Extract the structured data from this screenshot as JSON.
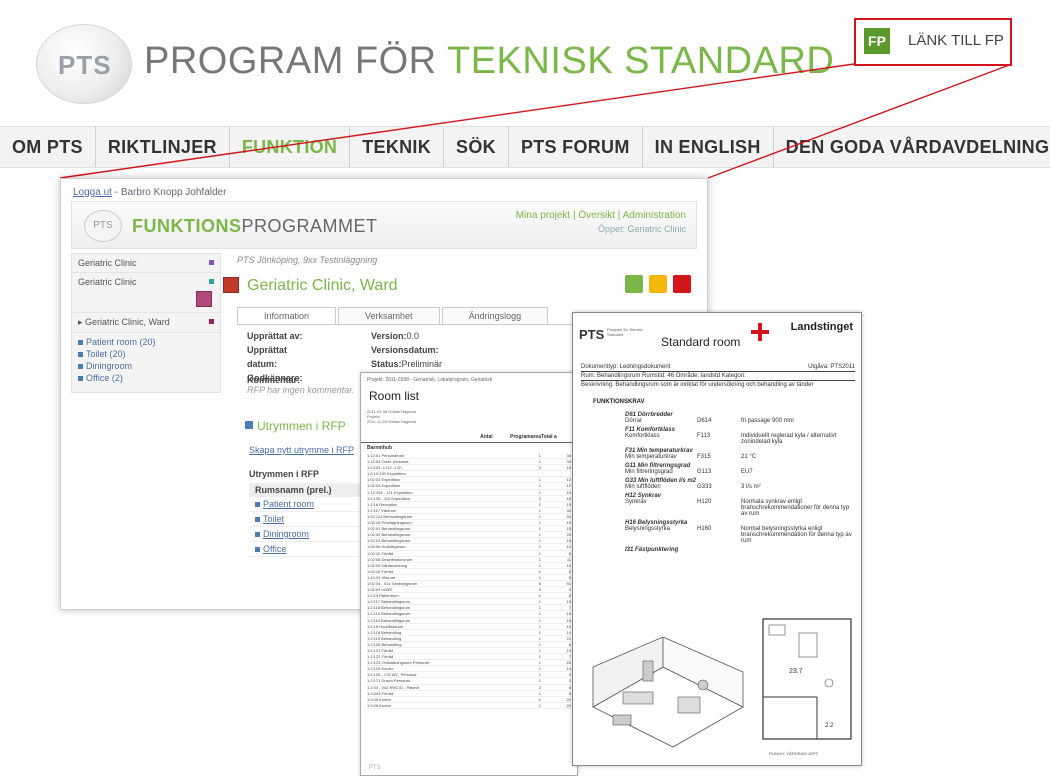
{
  "site": {
    "logo": "PTS",
    "title_part1": "PROGRAM FÖR ",
    "title_part2": "TEKNISK STANDARD",
    "fp_badge": "FP",
    "fp_link": "LÄNK TILL FP"
  },
  "nav": [
    {
      "label": "OM PTS",
      "color": "#333333"
    },
    {
      "label": "RIKTLINJER",
      "color": "#333333"
    },
    {
      "label": "FUNKTION",
      "color": "#7ab648"
    },
    {
      "label": "TEKNIK",
      "color": "#333333"
    },
    {
      "label": "SÖK",
      "color": "#333333"
    },
    {
      "label": "PTS FORUM",
      "color": "#333333"
    },
    {
      "label": "IN ENGLISH",
      "color": "#333333"
    },
    {
      "label": "DEN GODA VÅRDAVDELNINGEN",
      "color": "#333333"
    }
  ],
  "app": {
    "logout_link": "Logga ut",
    "user": " - Barbro Knopp Johfalder",
    "logo": "PTS",
    "title_part1": "FUNKTIONS",
    "title_part2": "PROGRAMMET",
    "links": "Mina projekt | Översikt | Administration",
    "open": "Öppet: Geriatric Clinic",
    "left": {
      "rows": [
        {
          "label": "Geriatric Clinic",
          "dot": "#8a4fc0"
        },
        {
          "label": "Geriatric Clinic",
          "dot": "#2aa3a3"
        }
      ],
      "ward": "▸ Geriatric Clinic, Ward",
      "ward_dot": "#a0245a",
      "items": [
        "Patient room (20)",
        "Toilet (20)",
        "Diningroom",
        "Office (2)"
      ]
    },
    "crumb": "PTS Jönköping, 9xx Testinläggning",
    "room_title": "Geriatric Clinic, Ward",
    "tabs": [
      "Information",
      "Verksamhet",
      "Ändringslogg"
    ],
    "info_left": [
      {
        "k": "Upprättat av:",
        "v": ""
      },
      {
        "k": "Upprättat datum:",
        "v": ""
      },
      {
        "k": "Godkännare:",
        "v": ""
      }
    ],
    "info_right": [
      {
        "k": "Version:",
        "v": "0.0"
      },
      {
        "k": "Versionsdatum:",
        "v": ""
      },
      {
        "k": "Status:",
        "v": "Preliminär"
      }
    ],
    "komm_label": "Kommentar:",
    "komm_text": "RFP har ingen kommentar.",
    "utr_title": "Utrymmen i RFP",
    "utr_new": "Skapa nytt utrymme i RFP",
    "utr_list": "Utrymmen i RFP",
    "utr_th": "Rumsnamn (prel.)",
    "utr_rows": [
      "Patient room",
      "Toilet",
      "Diningroom",
      "Office"
    ]
  },
  "roomlist": {
    "top": "Projekt: 2011-0398 - Geriatrisk, Lokalprogram, Geriatrisk",
    "title": "Room list",
    "meta": [
      "2011-09-08  Gösan Hagtund",
      "Projekt:",
      "2011-11-26  Gösan Hagtund"
    ],
    "cols": [
      "",
      "Antal",
      "Programarea",
      "Total a"
    ],
    "section": "Barnmhub",
    "rows": [
      [
        "1:12:01 Personalrum",
        "1",
        "34"
      ],
      [
        "1:12:03 Omkl. personal",
        "1",
        "34"
      ],
      [
        "1:2:103 -1.f12 -1.f2 -",
        "2",
        "15"
      ],
      [
        "1:5 10:230 Expedition",
        "",
        ""
      ],
      [
        "1:02:03 Expedition",
        "1",
        "12"
      ],
      [
        "1:02:04 Expedition",
        "1",
        "12"
      ],
      [
        "1:12:104 - 121 Expedition",
        "1",
        "10"
      ],
      [
        "1:2:105 - 110 Expedition",
        "2",
        "16"
      ],
      [
        "1:2:16 Reception",
        "1",
        "15"
      ],
      [
        "1:2:117 Väntrum",
        "1",
        "30"
      ],
      [
        "1:02:114 Behandlingsrum",
        "1",
        "20"
      ],
      [
        "1:02:15 Provtagningsrum",
        "1",
        "10"
      ],
      [
        "1:02:01 Behandlingsrum",
        "1",
        "15"
      ],
      [
        "1:02:02 Behandlingsrum",
        "1",
        "20"
      ],
      [
        "1:02:03 Behandlingsrum",
        "1",
        "15"
      ],
      [
        "1:02:06 Hudvårgsrum",
        "1",
        "12"
      ],
      [
        "1:02:10 Förråd",
        "1",
        "6"
      ],
      [
        "1:02:08 Desinfektionsrum",
        "1",
        "11"
      ],
      [
        "1:02:05 Vårdavdelning",
        "1",
        "14"
      ],
      [
        "1:02:16 Förråd",
        "1",
        "6"
      ],
      [
        "1:10-01 Vilorum",
        "1",
        "5"
      ],
      [
        "1:02:04 - 014 Vänkningsrum",
        "6",
        "51"
      ],
      [
        "1:02:03 m/WC",
        "3",
        "3"
      ],
      [
        "1:2:13 Patientrum",
        "1",
        "8"
      ],
      [
        "1:2:117 Behandlingsrum",
        "1",
        "15"
      ],
      [
        "1:2:118 Behandlingsrum",
        "1",
        "7"
      ],
      [
        "1:2:110 Behandlingsrum",
        "1",
        "15"
      ],
      [
        "1:2:114 Behandlingsrum",
        "1",
        "15"
      ],
      [
        "1:2:16 Hudvårdsrum",
        "1",
        "15"
      ],
      [
        "1:2:118 Behandling",
        "1",
        "14"
      ],
      [
        "1:2:119 Behandling",
        "1",
        "21"
      ],
      [
        "1:2:120 Behandling",
        "1",
        "6"
      ],
      [
        "1:2:121 Förråd",
        "1",
        "13"
      ],
      [
        "1:2:122 Förråd",
        "1",
        "7"
      ],
      [
        "1:2:123 Omklädningsrum Personal",
        "1",
        "20"
      ],
      [
        "1:2:124 Kontor",
        "1",
        "14"
      ],
      [
        "1:2:125 - 176 WC, Personal",
        "1",
        "3"
      ],
      [
        "1:2:171 Dusch Personal",
        "1",
        "3"
      ],
      [
        "1:2:03 - 042 RWC/D - Patient",
        "2",
        "8"
      ],
      [
        "1:2:043 Förråd",
        "1",
        "8"
      ],
      [
        "1:2:05 Kontor",
        "1",
        "20"
      ],
      [
        "1:2:06 Kontor",
        "1",
        "20"
      ]
    ],
    "foot": "PTS"
  },
  "stdroom": {
    "logo": "PTS",
    "logo_sub": "Program för Teknisk Standard",
    "title": "Standard room",
    "org": "Landstinget",
    "meta": [
      {
        "l": "Dokumenttyp: Ledningsdokument",
        "r": "Utgåva: PTS2011"
      },
      {
        "l": "Rum:  Behandlingsrum   Rumstid:  46   Område: landstd   Kategori:",
        "r": ""
      },
      {
        "l": "Beskrivning:  Behandlingsrum som är inriktat för undersökning och behandling av tänder",
        "r": ""
      }
    ],
    "section": "FUNKTIONSKRAV",
    "reqs": [
      {
        "h": "D61 Dörrbredder"
      },
      {
        "a": "Dörrar",
        "b": "D614",
        "c": "fri passage 900 mm"
      },
      {
        "h": "F11 Komfortklass"
      },
      {
        "a": "Komfortklass",
        "b": "F113",
        "c": "Individuellt reglerad kyla / alternativt zonindelad kyla"
      },
      {
        "h": "F31 Min temperaturkrav"
      },
      {
        "a": "Min temperaturkrav",
        "b": "F315",
        "c": "21 °C"
      },
      {
        "h": "G11 Min filtreringsgrad"
      },
      {
        "a": "Min filtreringsgrad",
        "b": "G113",
        "c": "EU7"
      },
      {
        "h": "G33 Min luftflöden l/s m2"
      },
      {
        "a": "Min luftflöden",
        "b": "G333",
        "c": "3 l/s m²"
      },
      {
        "h": "H12 Synkrav"
      },
      {
        "a": "Synkrav",
        "b": "H120",
        "c": "Normala synkrav enligt branschrekommendationer för denna typ av rum"
      },
      {
        "h": "H16 Belysningsstyrka"
      },
      {
        "a": "Belysningsstyrka",
        "b": "H160",
        "c": "Normal belysningsstyrka enligt branschrekommendation för denna typ av rum"
      },
      {
        "h": "I31 Fästpunktering"
      }
    ],
    "caption": "PLANVY, VÅRDRUM 1BPS"
  }
}
